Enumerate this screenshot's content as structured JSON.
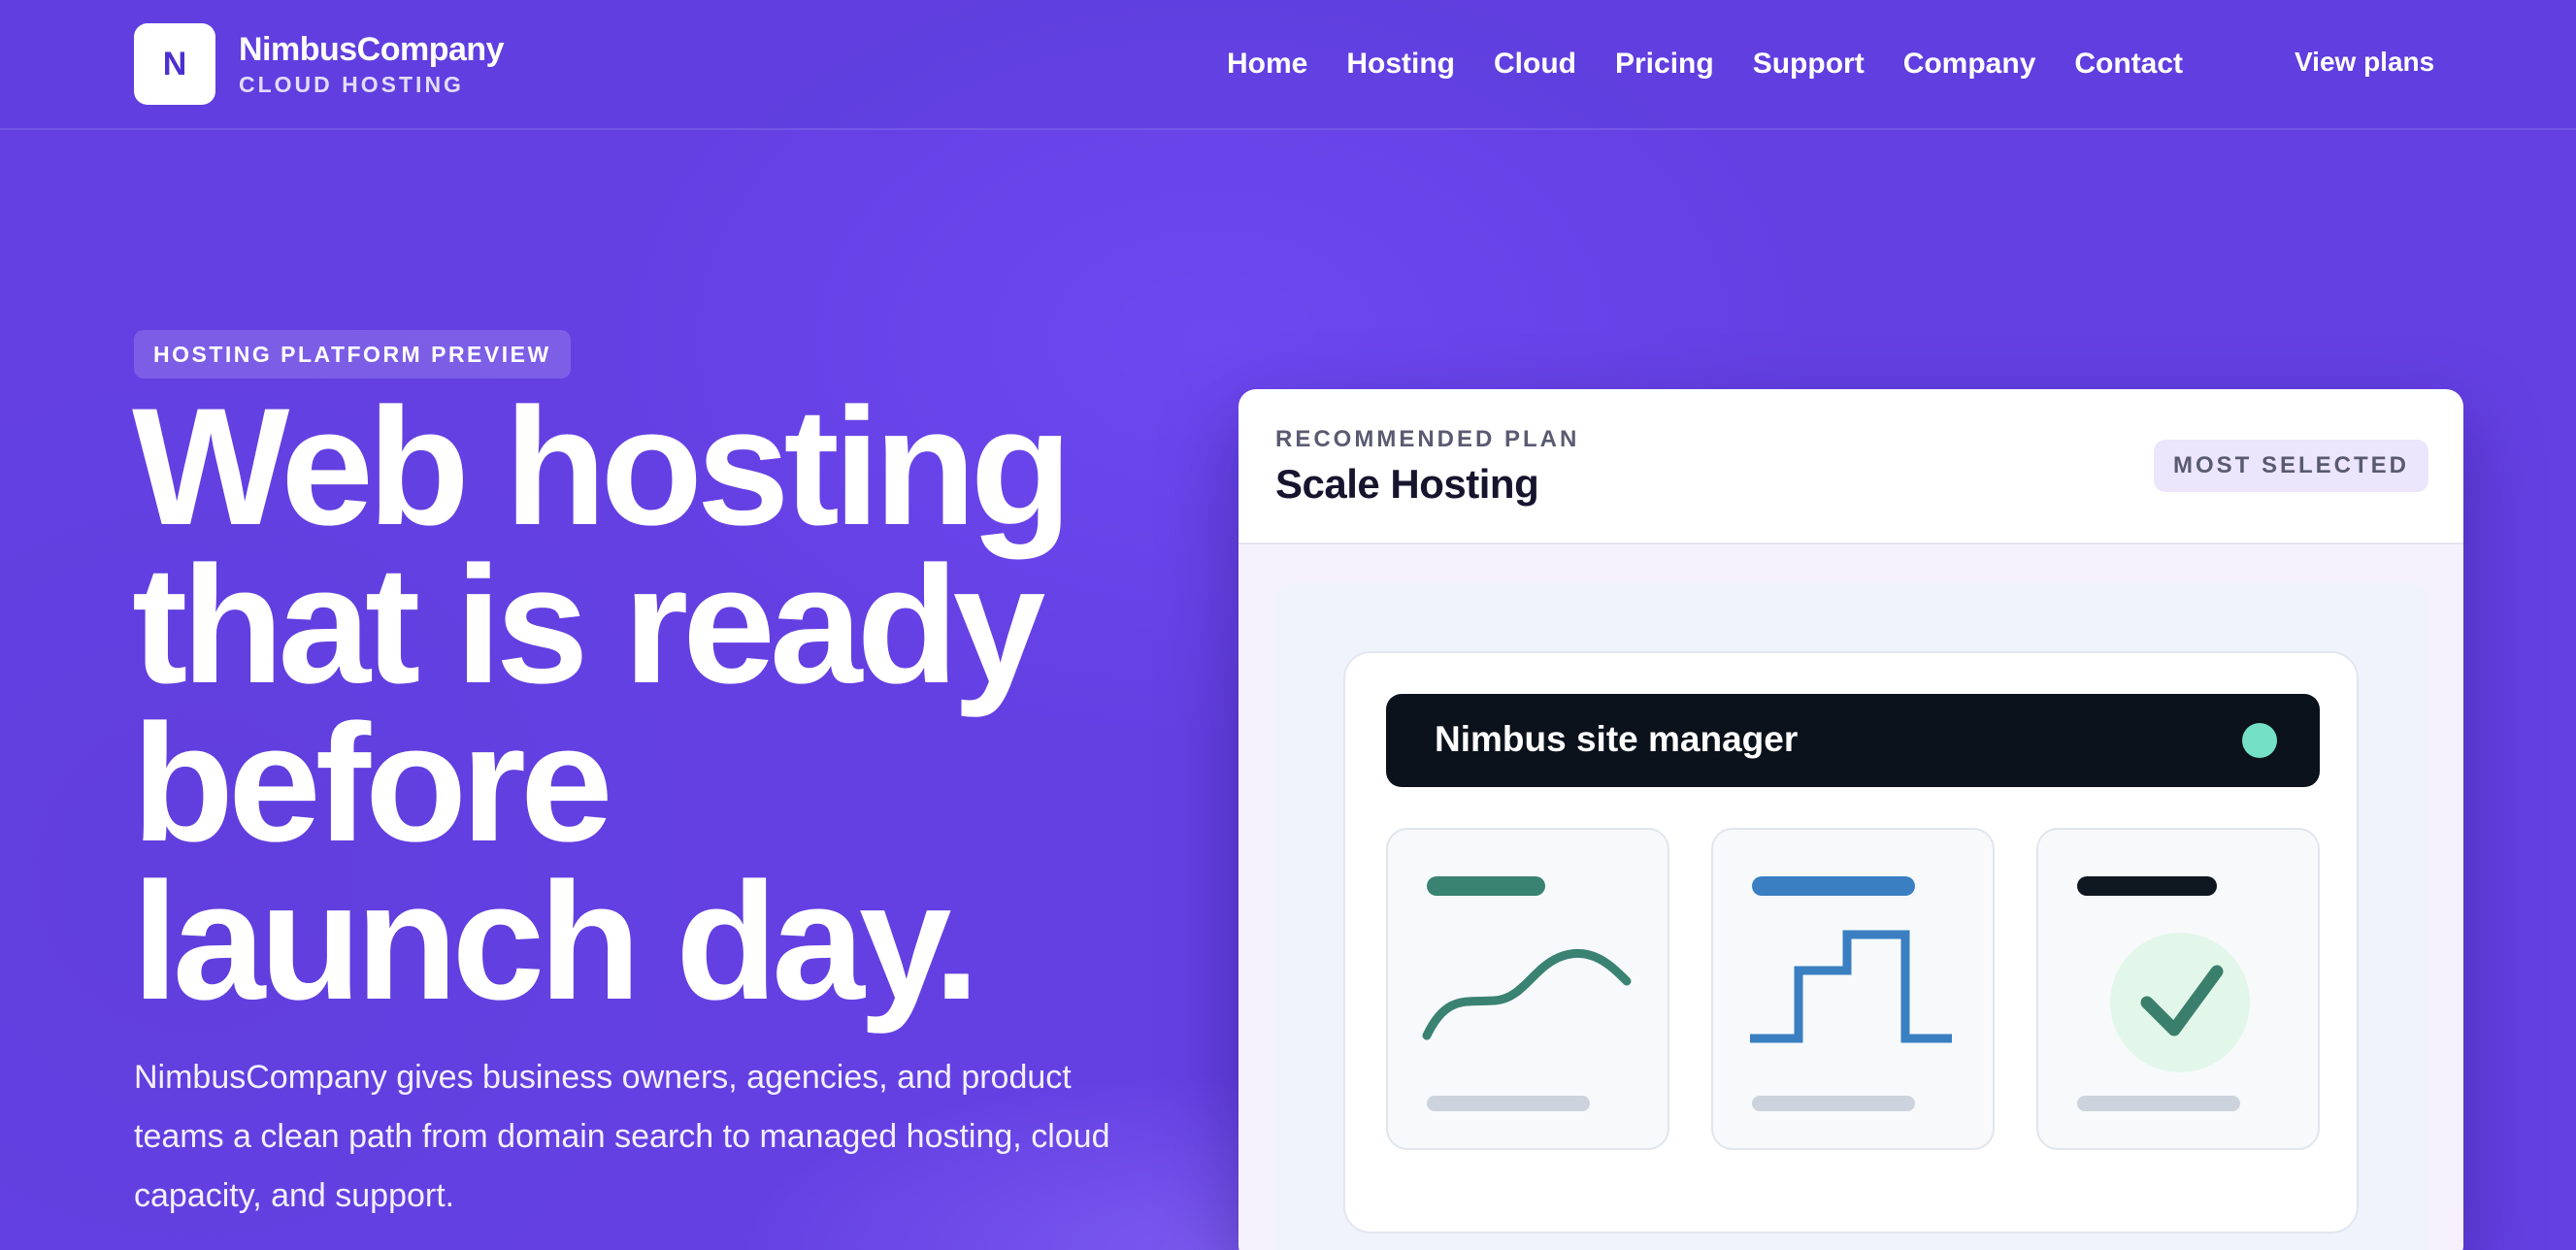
{
  "header": {
    "logo_letter": "N",
    "brand_name": "NimbusCompany",
    "brand_tagline": "CLOUD HOSTING",
    "nav": [
      "Home",
      "Hosting",
      "Cloud",
      "Pricing",
      "Support",
      "Company",
      "Contact"
    ],
    "cta_label": "View plans"
  },
  "hero": {
    "eyebrow": "HOSTING PLATFORM PREVIEW",
    "headline_lines": [
      "Web hosting",
      "that is ready",
      "before",
      "launch day."
    ],
    "lede": "NimbusCompany gives business owners, agencies, and product teams a clean path from domain search to managed hosting, cloud capacity, and support."
  },
  "plan_card": {
    "kicker": "RECOMMENDED PLAN",
    "title": "Scale Hosting",
    "badge": "MOST SELECTED",
    "preview": {
      "bar_title": "Nimbus site manager",
      "status_color": "#74e0c6",
      "tiles": [
        {
          "icon": "trend-line-icon",
          "accent": "#3a8272"
        },
        {
          "icon": "step-chart-icon",
          "accent": "#3a7fc1"
        },
        {
          "icon": "checkmark-icon",
          "accent": "#0f1720"
        }
      ]
    }
  },
  "colors": {
    "background": "#6440e3",
    "brand_accent": "#4d2fd0"
  }
}
